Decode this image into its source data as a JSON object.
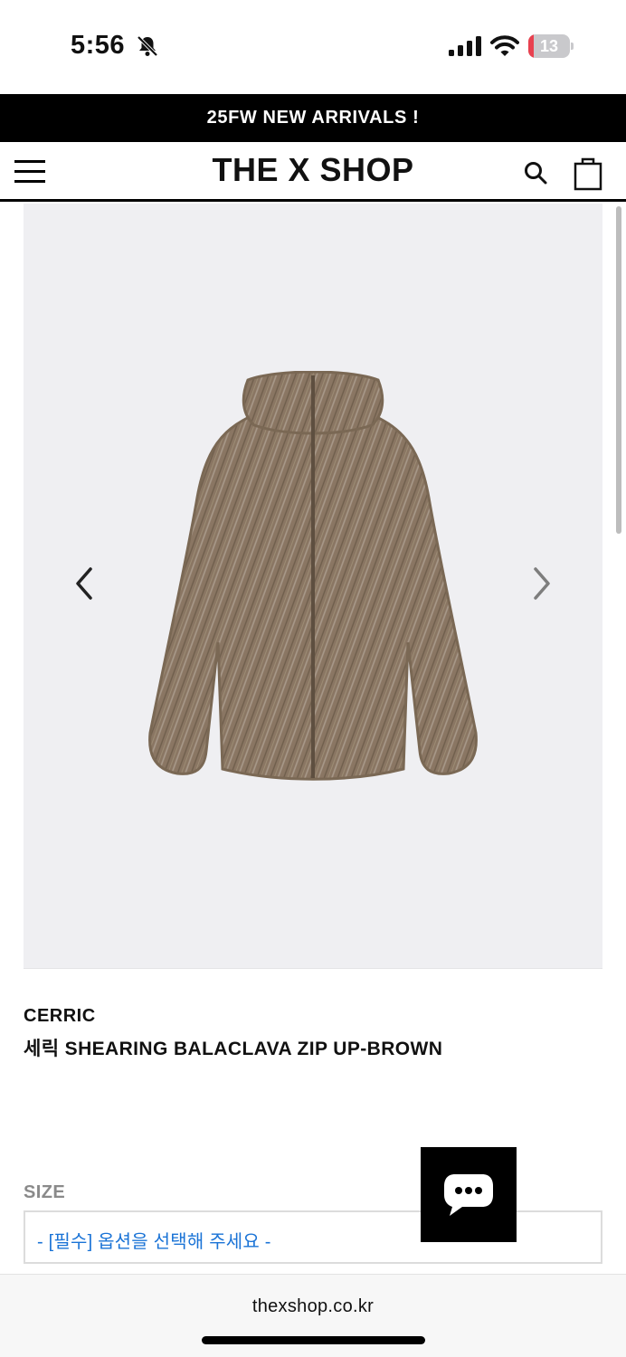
{
  "status_bar": {
    "time": "5:56",
    "battery_level": "13",
    "battery_fraction": 0.13,
    "battery_color": "#e8414f",
    "icons": [
      "bell-slash-icon",
      "cellular-signal-icon",
      "wifi-icon",
      "battery-icon"
    ]
  },
  "promo_banner": {
    "text": "25FW NEW ARRIVALS !"
  },
  "header": {
    "logo": "THE X SHOP",
    "icons": [
      "hamburger-menu-icon",
      "search-icon",
      "shopping-bag-icon"
    ]
  },
  "product": {
    "image_icons": [
      "chevron-left-icon",
      "chevron-right-icon"
    ],
    "brand": "CERRIC",
    "name": "세릭 SHEARING BALACLAVA ZIP UP-BROWN"
  },
  "options": {
    "size_label": "SIZE",
    "size_placeholder": "- [필수] 옵션을 선택해 주세요 -",
    "accent_color": "#1a73d6"
  },
  "chat": {
    "icon": "chat-bubble-icon"
  },
  "browser": {
    "url": "thexshop.co.kr"
  }
}
